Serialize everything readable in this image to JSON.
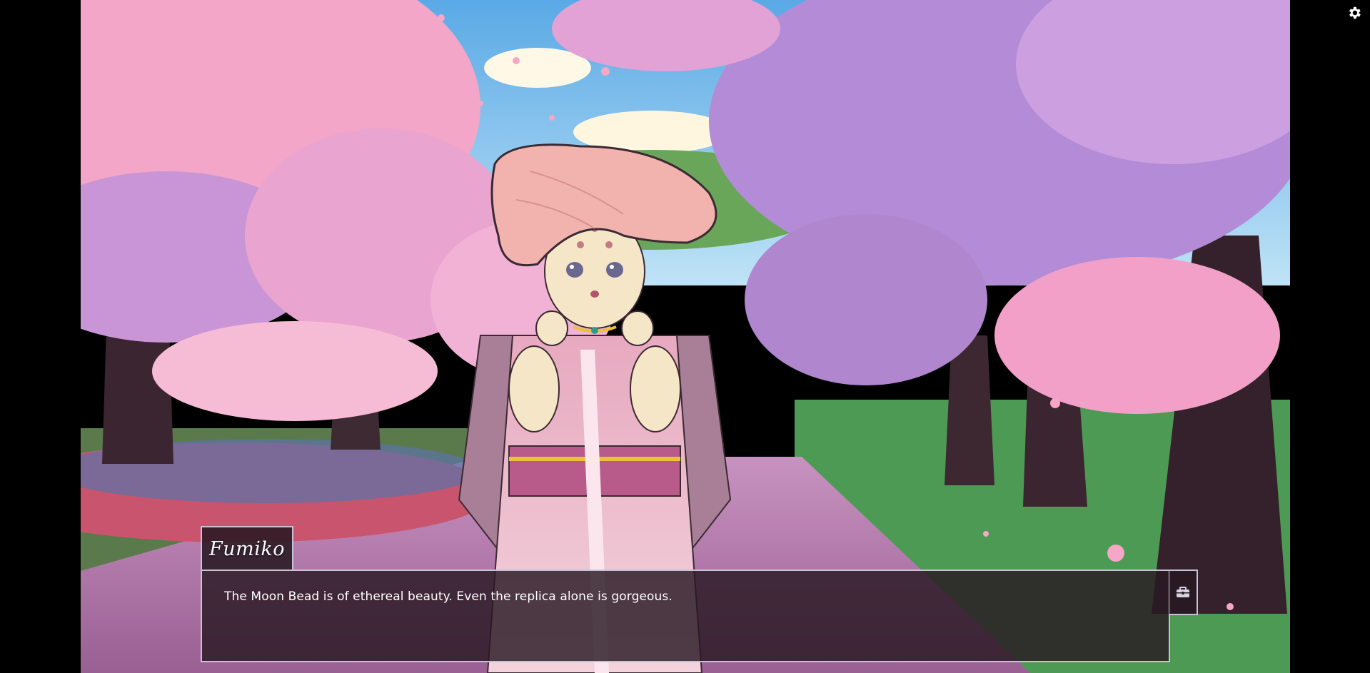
{
  "scene": {
    "background": "cherry-blossom-park-path",
    "character": "fumiko-mushroom-girl",
    "colors": {
      "sky": "#7fc6ee",
      "blossom_pink": "#f3a6c8",
      "blossom_purple": "#b48bd6",
      "path": "#b07aa8",
      "grass": "#4d9a55",
      "trunk": "#3a2530"
    }
  },
  "dialogue": {
    "speaker": "Fumiko",
    "text": "The Moon Bead is of ethereal beauty. Even the replica alone is gorgeous."
  },
  "controls": {
    "settings_icon": "gear-icon",
    "inventory_icon": "toolbox-icon"
  }
}
